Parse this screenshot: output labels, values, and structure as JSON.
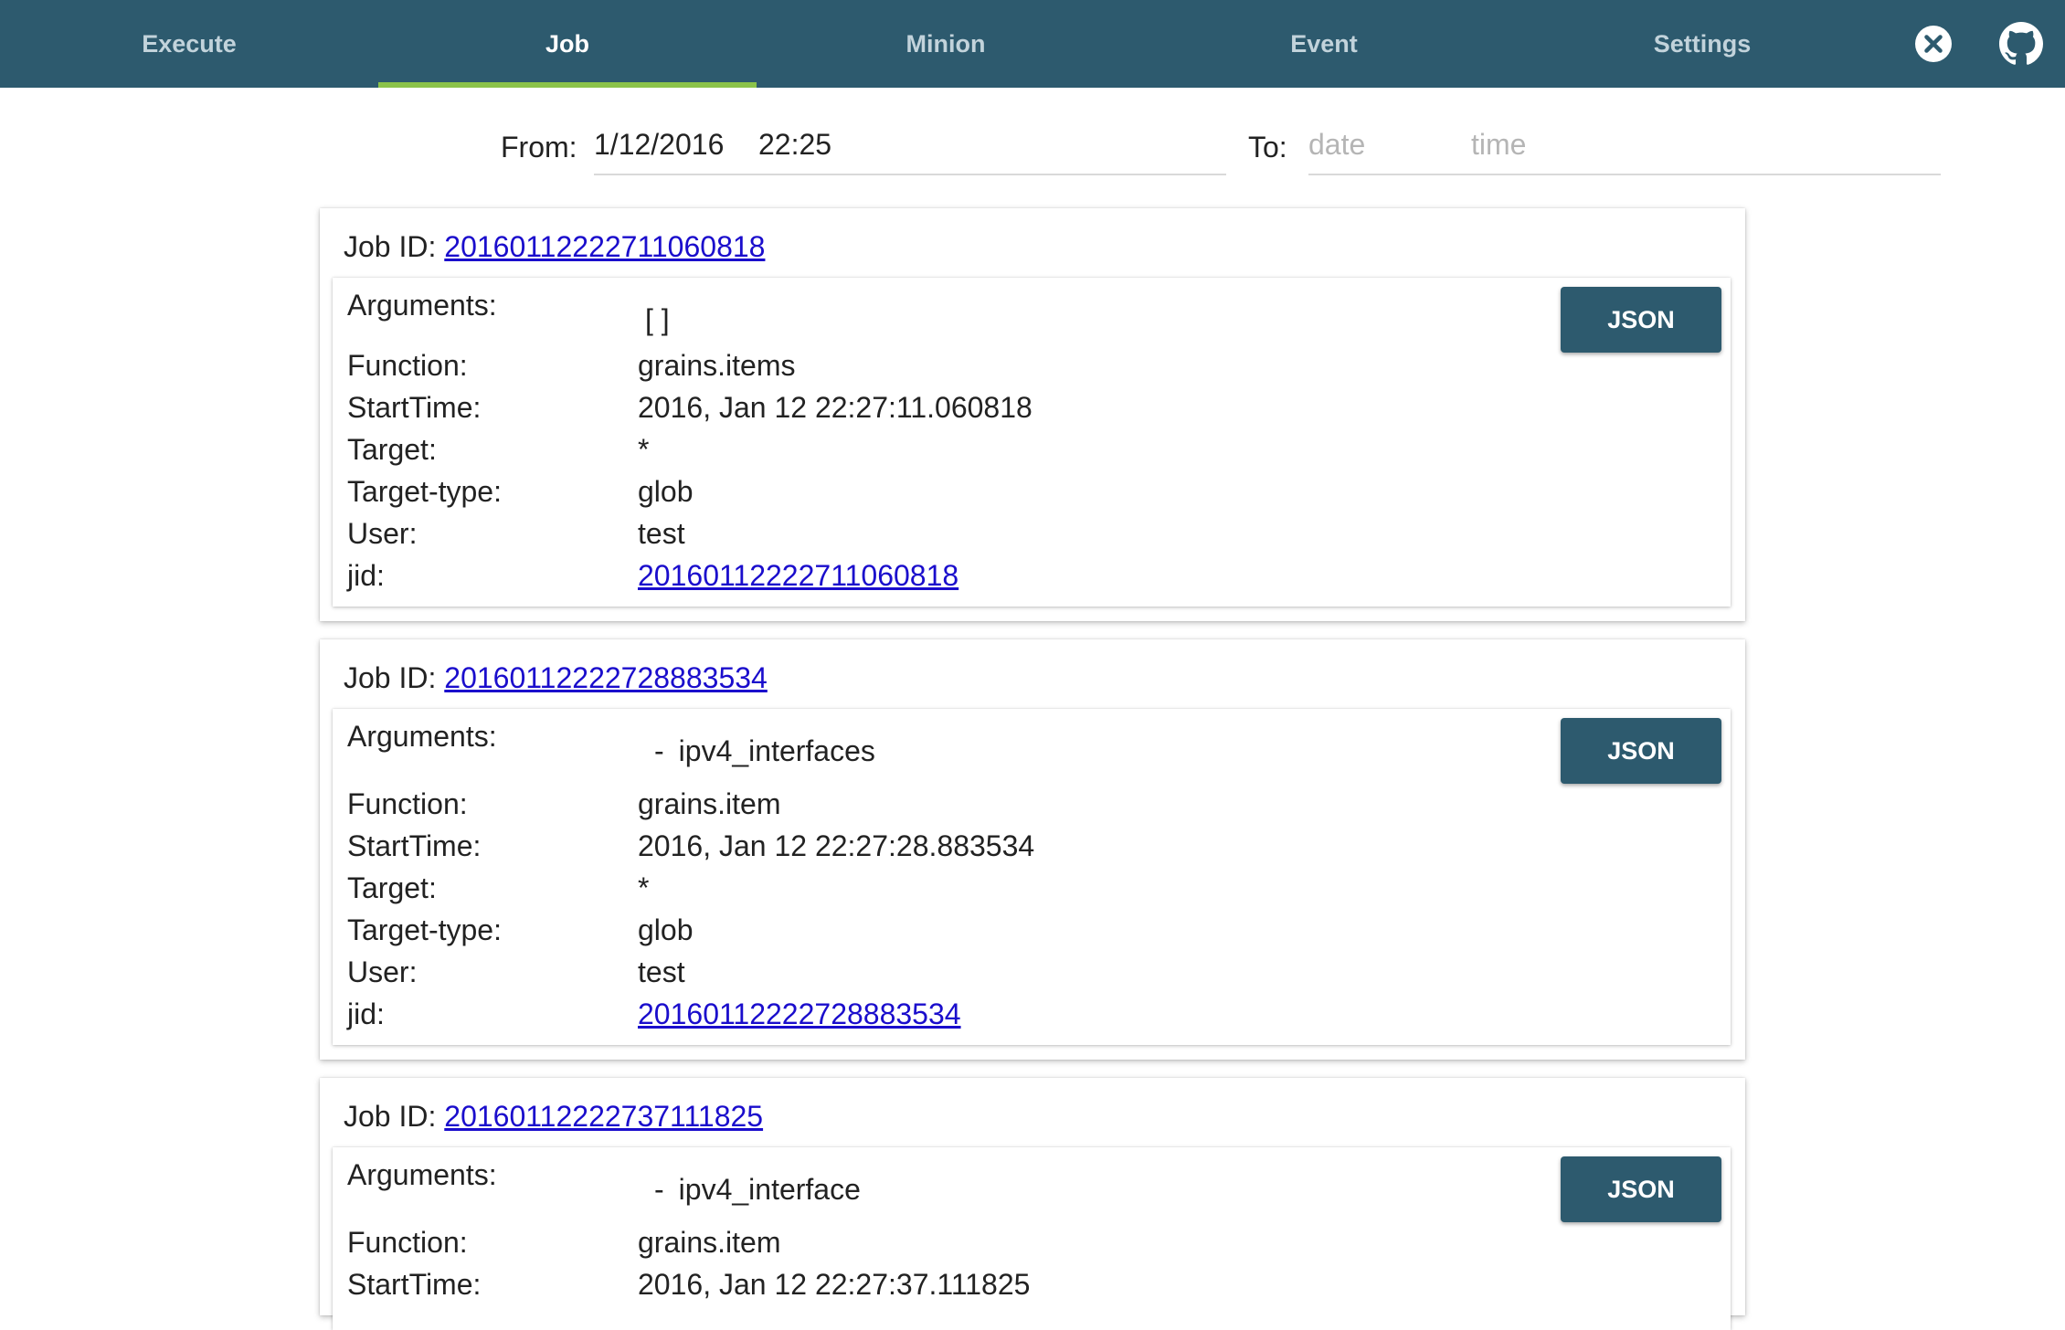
{
  "nav": {
    "tabs": [
      {
        "label": "Execute",
        "active": false
      },
      {
        "label": "Job",
        "active": true
      },
      {
        "label": "Minion",
        "active": false
      },
      {
        "label": "Event",
        "active": false
      },
      {
        "label": "Settings",
        "active": false
      }
    ],
    "icons": [
      "close-circle-icon",
      "github-icon"
    ],
    "background_color": "#2d5a6e",
    "active_underline_color": "#8bc34a"
  },
  "filter": {
    "from_label": "From:",
    "from_date": "1/12/2016",
    "from_time": "22:25",
    "to_label": "To:",
    "to_date_placeholder": "date",
    "to_time_placeholder": "time"
  },
  "job_id_label": "Job ID:",
  "json_button_label": "JSON",
  "field_labels": {
    "arguments": "Arguments:",
    "function": "Function:",
    "starttime": "StartTime:",
    "target": "Target:",
    "target_type": "Target-type:",
    "user": "User:",
    "jid": "jid:"
  },
  "jobs": [
    {
      "id": "20160112222711060818",
      "arguments": "[ ]",
      "arguments_is_list": false,
      "function": "grains.items",
      "starttime": "2016, Jan 12 22:27:11.060818",
      "target": "*",
      "target_type": "glob",
      "user": "test",
      "jid": "20160112222711060818"
    },
    {
      "id": "20160112222728883534",
      "arguments": "ipv4_interfaces",
      "arguments_is_list": true,
      "function": "grains.item",
      "starttime": "2016, Jan 12 22:27:28.883534",
      "target": "*",
      "target_type": "glob",
      "user": "test",
      "jid": "20160112222728883534"
    },
    {
      "id": "20160112222737111825",
      "arguments": "ipv4_interface",
      "arguments_is_list": true,
      "function": "grains.item",
      "starttime": "2016, Jan 12 22:27:37.111825"
    }
  ]
}
